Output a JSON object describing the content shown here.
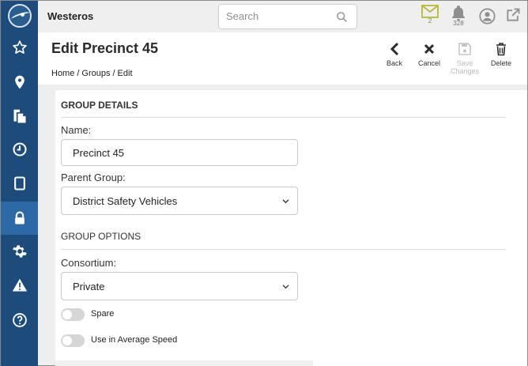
{
  "app": {
    "name": "Westeros"
  },
  "search": {
    "placeholder": "Search"
  },
  "top_icons": {
    "messages_count": "2",
    "notifications_count": "328",
    "accent_messages": "#b8b83a"
  },
  "sidebar": {
    "items": [
      {
        "name": "favorites",
        "icon": "star-icon"
      },
      {
        "name": "locations",
        "icon": "map-pin-icon"
      },
      {
        "name": "reports",
        "icon": "documents-icon"
      },
      {
        "name": "history",
        "icon": "clock-icon"
      },
      {
        "name": "devices",
        "icon": "tablet-icon"
      },
      {
        "name": "security",
        "icon": "lock-icon",
        "active": true
      },
      {
        "name": "settings",
        "icon": "gear-icon"
      },
      {
        "name": "alerts",
        "icon": "warning-icon"
      },
      {
        "name": "help",
        "icon": "help-icon"
      }
    ],
    "bg_color": "#1c4b7c",
    "active_color": "#2d6aa5"
  },
  "header": {
    "title": "Edit Precinct 45",
    "breadcrumb": [
      "Home",
      "/",
      "Groups",
      "/",
      "Edit"
    ],
    "actions": {
      "back": "Back",
      "cancel": "Cancel",
      "save_line1": "Save",
      "save_line2": "Changes",
      "delete": "Delete"
    }
  },
  "group_details": {
    "title": "GROUP DETAILS",
    "name_label": "Name:",
    "name_value": "Precinct 45",
    "parent_label": "Parent Group:",
    "parent_value": "District Safety Vehicles"
  },
  "group_options": {
    "title": "GROUP OPTIONS",
    "consortium_label": "Consortium:",
    "consortium_value": "Private",
    "spare_label": "Spare",
    "spare_on": false,
    "avg_speed_label": "Use in Average Speed",
    "avg_speed_on": false
  }
}
